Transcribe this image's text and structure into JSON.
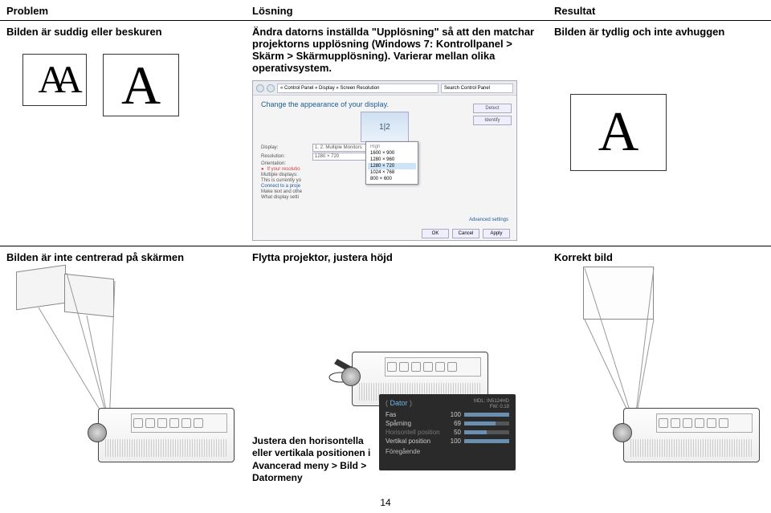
{
  "headers": {
    "problem": "Problem",
    "solution": "Lösning",
    "result": "Resultat"
  },
  "row1": {
    "problem": "Bilden är suddig eller beskuren",
    "solution": "Ändra datorns inställda \"Upplösning\" så att den matchar projektorns upplösning (Windows 7: Kontrollpanel > Skärm > Skärmupplösning). Varierar mellan olika operativsystem.",
    "result": "Bilden är tydlig och inte avhuggen",
    "letterA_double": "AA",
    "letterA": "A",
    "win7": {
      "addr": "« Control Panel » Display » Screen Resolution",
      "search": "Search Control Panel",
      "title": "Change the appearance of your display.",
      "btn_detect": "Detect",
      "btn_identify": "Identify",
      "display_lbl": "Display:",
      "display_val": "1. 2. Multiple Monitors",
      "res_lbl": "Resolution:",
      "res_val": "1280 × 720",
      "orient_lbl": "Orientation:",
      "mult_lbl": "Multiple displays:",
      "note1": "This is currently yo",
      "note2": "Connect to a proje",
      "note3": "Make text and othe",
      "note4": "What display setti",
      "note5": "If your resolutio",
      "adv": "Advanced settings",
      "popup_hdr": "High",
      "popup": [
        "1600 × 900",
        "1280 × 960",
        "1280 × 720",
        "1024 × 768",
        "800 × 600"
      ],
      "popup_sel": 2,
      "ok": "OK",
      "cancel": "Cancel",
      "apply": "Apply"
    }
  },
  "row2": {
    "problem": "Bilden är inte centrerad på skärmen",
    "solution": "Flytta projektor, justera höjd",
    "result": "Korrekt bild",
    "adjust": "Justera den horisontella eller vertikala positionen i Avancerad meny > Bild > Datormeny",
    "osd": {
      "paren_l": "(",
      "paren_r": ")",
      "src": "Dator",
      "model": "MDL: IN5124HD",
      "fw": "FW: 0.19",
      "rows": [
        {
          "label": "Fas",
          "dim": false,
          "val": "100",
          "pct": 100
        },
        {
          "label": "Spårning",
          "dim": false,
          "val": "69",
          "pct": 69
        },
        {
          "label": "Horisontell position",
          "dim": true,
          "val": "50",
          "pct": 50
        },
        {
          "label": "Vertikal position",
          "dim": false,
          "val": "100",
          "pct": 100
        }
      ],
      "prev": "Föregående"
    }
  },
  "page": "14"
}
